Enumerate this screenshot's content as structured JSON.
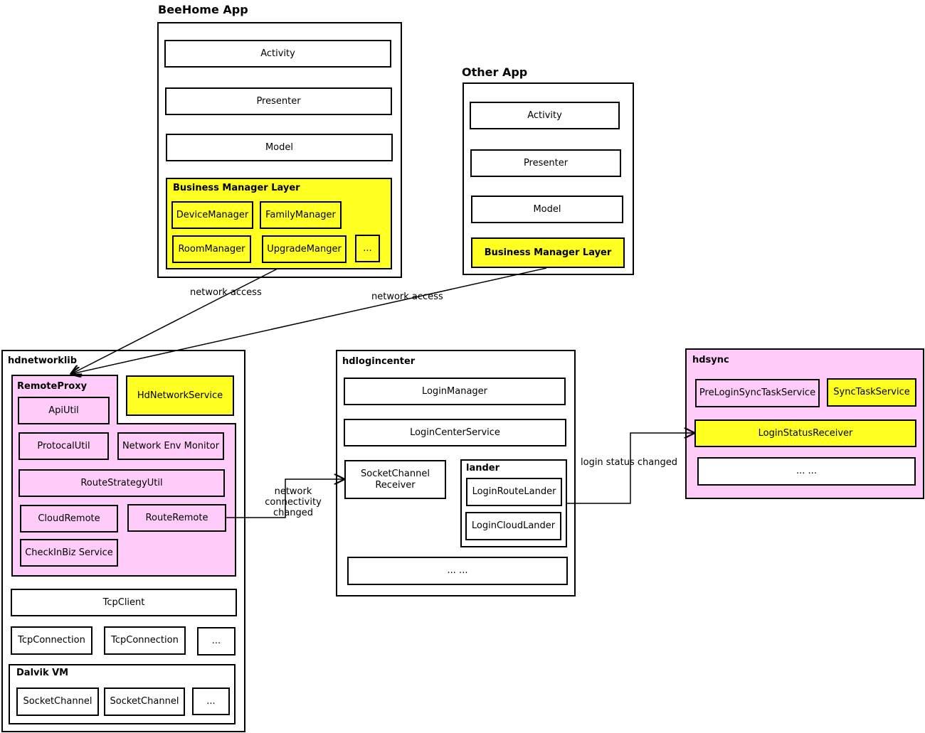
{
  "beehome": {
    "title": "BeeHome App",
    "activity": "Activity",
    "presenter": "Presenter",
    "model": "Model",
    "bml": {
      "title": "Business Manager Layer",
      "device": "DeviceManager",
      "family": "FamilyManager",
      "room": "RoomManager",
      "upgrade": "UpgradeManger",
      "more": "..."
    }
  },
  "other": {
    "title": "Other App",
    "activity": "Activity",
    "presenter": "Presenter",
    "model": "Model",
    "bml": "Business Manager Layer"
  },
  "edges": {
    "access1": "network access",
    "access2": "network access",
    "connectivity": "network connectivity\nchanged",
    "login_status": "login status changed"
  },
  "hdnetworklib": {
    "title": "hdnetworklib",
    "remote_proxy": {
      "title": "RemoteProxy",
      "api": "ApiUtil",
      "protocal": "ProtocalUtil",
      "env": "Network Env Monitor",
      "strategy": "RouteStrategyUtil",
      "cloud": "CloudRemote",
      "route": "RouteRemote",
      "checkin": "CheckInBiz Service"
    },
    "service": "HdNetworkService",
    "tcpclient": "TcpClient",
    "conn1": "TcpConnection",
    "conn2": "TcpConnection",
    "conn_more": "...",
    "dalvik": {
      "title": "Dalvik VM",
      "sc1": "SocketChannel",
      "sc2": "SocketChannel",
      "more": "..."
    }
  },
  "hdlogincenter": {
    "title": "hdlogincenter",
    "manager": "LoginManager",
    "service": "LoginCenterService",
    "socket": "SocketChannel\nReceiver",
    "lander": {
      "title": "lander",
      "route": "LoginRouteLander",
      "cloud": "LoginCloudLander"
    },
    "more": "... ..."
  },
  "hdsync": {
    "title": "hdsync",
    "prelogin": "PreLoginSyncTaskService",
    "sync": "SyncTaskService",
    "receiver": "LoginStatusReceiver",
    "more": "... ..."
  },
  "colors": {
    "business": "#ffff22",
    "network": "#ffccf9"
  }
}
